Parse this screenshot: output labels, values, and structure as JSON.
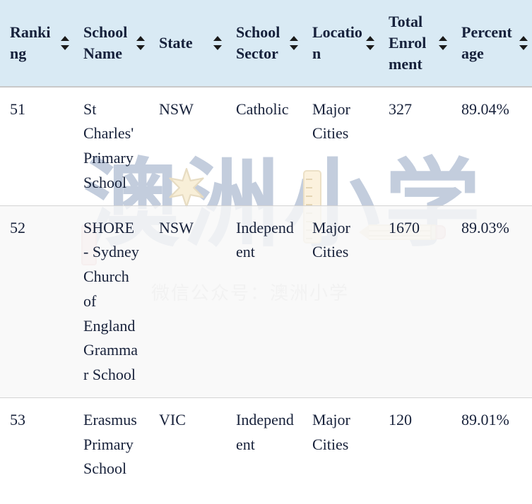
{
  "table": {
    "sort_icon_name": "sort-updown-icon",
    "columns": [
      {
        "key": "ranking",
        "label": "Ranking",
        "sortable": true
      },
      {
        "key": "name",
        "label": "School Name",
        "sortable": true
      },
      {
        "key": "state",
        "label": "State",
        "sortable": true
      },
      {
        "key": "sector",
        "label": "School Sector",
        "sortable": true
      },
      {
        "key": "location",
        "label": "Location",
        "sortable": true
      },
      {
        "key": "enrolment",
        "label": "Total Enrolment",
        "sortable": true
      },
      {
        "key": "percentage",
        "label": "Percentage",
        "sortable": true
      }
    ],
    "rows": [
      {
        "ranking": "51",
        "name": "St Charles' Primary School",
        "state": "NSW",
        "sector": "Catholic",
        "location": "Major Cities",
        "enrolment": "327",
        "percentage": "89.04%"
      },
      {
        "ranking": "52",
        "name": "SHORE - Sydney Church of England Grammar School",
        "state": "NSW",
        "sector": "Independent",
        "location": "Major Cities",
        "enrolment": "1670",
        "percentage": "89.03%"
      },
      {
        "ranking": "53",
        "name": "Erasmus Primary School",
        "state": "VIC",
        "sector": "Independent",
        "location": "Major Cities",
        "enrolment": "120",
        "percentage": "89.01%"
      }
    ]
  },
  "watermark": {
    "big_text": "澳洲小学",
    "small_text": "微信公众号：澳洲小学",
    "big_color": "#c3cddd",
    "small_color": "#d6d6d6",
    "accent_cream": "#fbf1dd",
    "accent_pink": "#f4dede"
  },
  "colors": {
    "header_background": "#d9eaf4",
    "header_text": "#16213b",
    "body_text": "#17213a",
    "row_stripe": "#f8f8f8",
    "row_border": "#d4d4d4",
    "header_border": "#c9c9c9"
  }
}
